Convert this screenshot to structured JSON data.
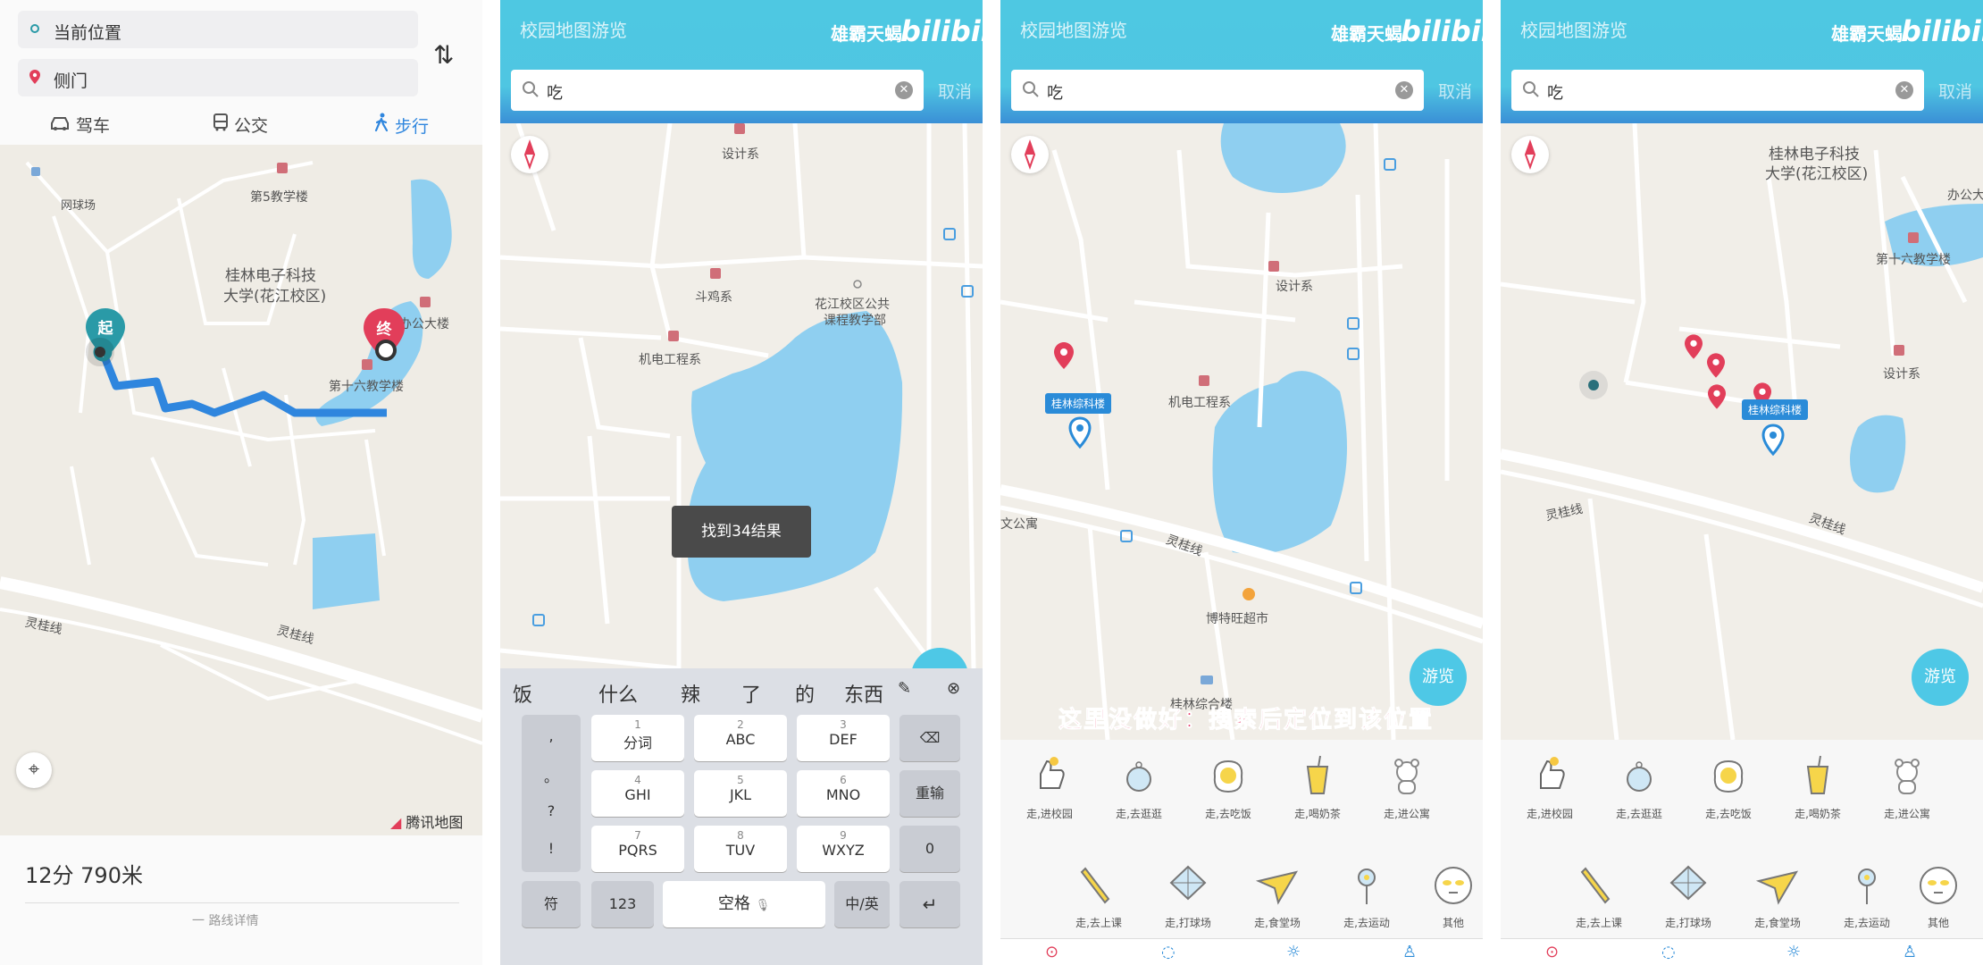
{
  "panel1": {
    "origin": "当前位置",
    "destination": "侧门",
    "modes": [
      {
        "label": "驾车",
        "icon": "car-icon"
      },
      {
        "label": "公交",
        "icon": "bus-icon"
      },
      {
        "label": "步行",
        "icon": "walk-icon",
        "active": true
      }
    ],
    "map_labels": [
      "网球场",
      "第5教学楼",
      "桂林电子科技",
      "大学(花江校区)",
      "办公大楼",
      "第十六教学楼",
      "灵桂线",
      "灵桂线"
    ],
    "start_marker": "起",
    "end_marker": "终",
    "eta": "12分 790米",
    "eta_sub": "一 路线详情",
    "attribution": "腾讯地图",
    "route_color": "#2f86de"
  },
  "app": {
    "title": "校园地图游览",
    "brand_zh": "雄霸天蝎",
    "brand_bili": "bilibili",
    "search_query": "吃",
    "search_button": "取消",
    "browse_button": "游览",
    "header_color": "#4ec8e2"
  },
  "panel2": {
    "map_labels": [
      "设计系",
      "斗鸡系",
      "花江校区公共",
      "课程教学部",
      "机电工程系"
    ],
    "toast": "找到34结果",
    "candidates": [
      "饭",
      "什么",
      "辣",
      "了",
      "的",
      "东西"
    ],
    "keys": [
      {
        "num": "1",
        "label": "分词"
      },
      {
        "num": "2",
        "label": "ABC"
      },
      {
        "num": "3",
        "label": "DEF"
      },
      {
        "num": "4",
        "label": "GHI"
      },
      {
        "num": "5",
        "label": "JKL"
      },
      {
        "num": "6",
        "label": "MNO"
      },
      {
        "num": "7",
        "label": "PQRS"
      },
      {
        "num": "8",
        "label": "TUV"
      },
      {
        "num": "9",
        "label": "WXYZ"
      }
    ],
    "punctuation": [
      ",",
      "。",
      "?",
      "!"
    ],
    "side_keys": [
      "重输",
      "0"
    ],
    "bottom_keys": {
      "symbol": "符",
      "num": "123",
      "space": "空格",
      "lang": "中/英"
    }
  },
  "panel3": {
    "map_labels": [
      "设计系",
      "机电工程系",
      "灵桂线",
      "博特旺超市",
      "文公寓",
      "桂林综合楼"
    ],
    "selected_place": "桂林综科楼",
    "caption": "这里没做好：搜索后定位到该位置"
  },
  "panel4": {
    "map_labels": [
      "桂林电子科技",
      "大学(花江校区)",
      "办公大",
      "第十六教学楼",
      "设计系",
      "灵桂线",
      "灵桂线"
    ],
    "selected_place": "桂林综科楼"
  },
  "categories": [
    {
      "label": "走,进校园",
      "icon": "thumbs-up-icon"
    },
    {
      "label": "走,去逛逛",
      "icon": "globe-icon"
    },
    {
      "label": "走,去吃饭",
      "icon": "fried-egg-icon"
    },
    {
      "label": "走,喝奶茶",
      "icon": "drink-cup-icon"
    },
    {
      "label": "走,进公寓",
      "icon": "bear-icon"
    },
    {
      "label": "走,去上课",
      "icon": "pencil-icon"
    },
    {
      "label": "走,打球场",
      "icon": "kite-icon"
    },
    {
      "label": "走,食堂场",
      "icon": "paper-plane-icon"
    },
    {
      "label": "走,去运动",
      "icon": "flower-icon"
    },
    {
      "label": "其他",
      "icon": "face-icon"
    }
  ]
}
